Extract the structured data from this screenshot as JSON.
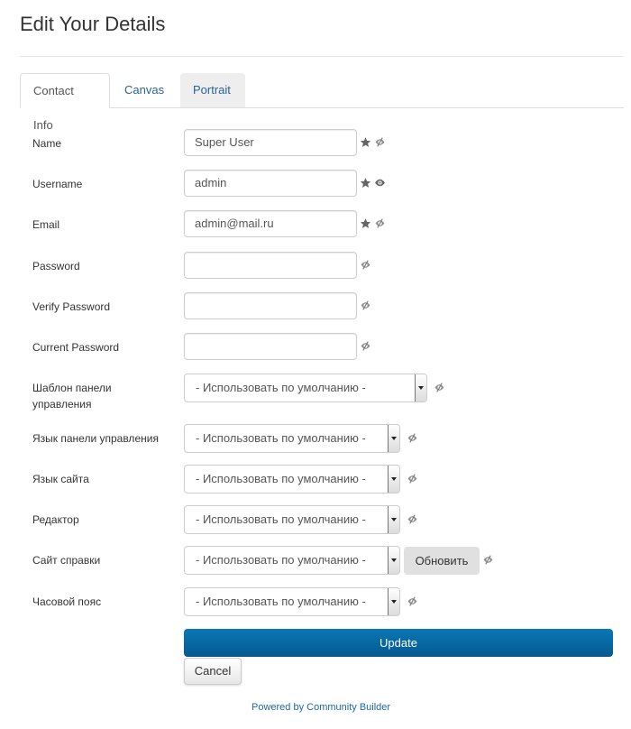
{
  "page": {
    "title": "Edit Your Details"
  },
  "tabs": [
    {
      "label": "Contact Info",
      "active": true
    },
    {
      "label": "Canvas",
      "active": false
    },
    {
      "label": "Portrait",
      "active": false
    }
  ],
  "fields": {
    "name": {
      "label": "Name",
      "value": "Super User",
      "required": true,
      "visibility": "hidden-eye"
    },
    "username": {
      "label": "Username",
      "value": "admin",
      "required": true,
      "visibility": "eye"
    },
    "email": {
      "label": "Email",
      "value": "admin@mail.ru",
      "required": true,
      "visibility": "hidden-eye"
    },
    "password": {
      "label": "Password",
      "value": "",
      "visibility": "hidden-eye"
    },
    "verify_password": {
      "label": "Verify Password",
      "value": "",
      "visibility": "hidden-eye"
    },
    "current_password": {
      "label": "Current Password",
      "value": "",
      "visibility": "hidden-eye"
    },
    "admin_template": {
      "label": "Шаблон панели управления",
      "value": "- Использовать по умолчанию -"
    },
    "admin_language": {
      "label": "Язык панели управления",
      "value": "- Использовать по умолчанию -"
    },
    "site_language": {
      "label": "Язык сайта",
      "value": "- Использовать по умолчанию -"
    },
    "editor": {
      "label": "Редактор",
      "value": "- Использовать по умолчанию -"
    },
    "help_site": {
      "label": "Сайт справки",
      "value": "- Использовать по умолчанию -",
      "refresh_label": "Обновить"
    },
    "timezone": {
      "label": "Часовой пояс",
      "value": "- Использовать по умолчанию -"
    }
  },
  "actions": {
    "update_label": "Update",
    "cancel_label": "Cancel"
  },
  "footer": {
    "powered_by": "Powered by Community Builder"
  },
  "colors": {
    "link": "#2a6496",
    "primary_button": "#0a6aa6",
    "icon": "#666666"
  }
}
